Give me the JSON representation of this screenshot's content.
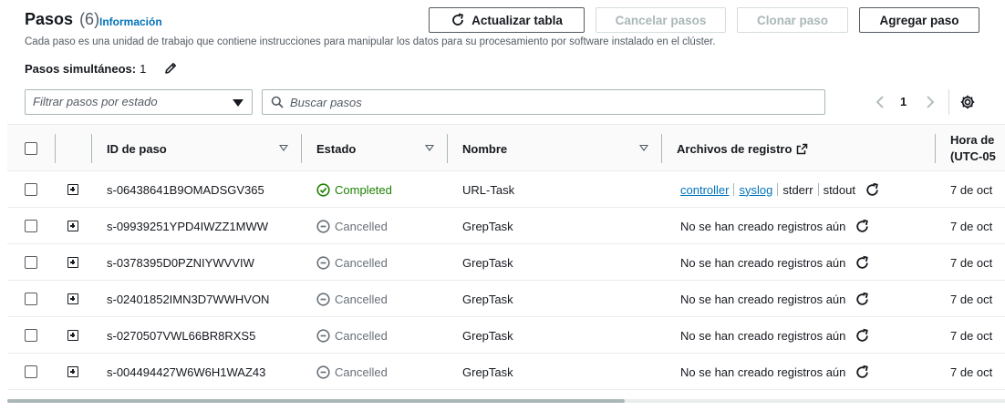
{
  "header": {
    "title": "Pasos",
    "count": "(6)",
    "info_link": "Información",
    "description": "Cada paso es una unidad de trabajo que contiene instrucciones para manipular los datos para su procesamiento por software instalado en el clúster.",
    "concurrent_label": "Pasos simultáneos:",
    "concurrent_value": "1",
    "edit_icon": "pencil-icon"
  },
  "toolbar": {
    "refresh_label": "Actualizar tabla",
    "cancel_label": "Cancelar pasos",
    "clone_label": "Clonar paso",
    "add_label": "Agregar paso"
  },
  "filters": {
    "state_placeholder": "Filtrar pasos por estado",
    "search_placeholder": "Buscar pasos"
  },
  "pagination": {
    "current_page": "1"
  },
  "table": {
    "columns": {
      "id": "ID de paso",
      "state": "Estado",
      "name": "Nombre",
      "logs": "Archivos de registro",
      "time_line1": "Hora de",
      "time_line2": "(UTC-05"
    },
    "rows": [
      {
        "id": "s-06438641B9OMADSGV365",
        "state": "Completed",
        "state_kind": "completed",
        "name": "URL-Task",
        "logs_kind": "links",
        "time": "7 de oct"
      },
      {
        "id": "s-09939251YPD4IWZZ1MWW",
        "state": "Cancelled",
        "state_kind": "cancelled",
        "name": "GrepTask",
        "logs_text": "No se han creado registros aún",
        "logs_kind": "none",
        "time": "7 de oct"
      },
      {
        "id": "s-0378395D0PZNIYWVVIW",
        "state": "Cancelled",
        "state_kind": "cancelled",
        "name": "GrepTask",
        "logs_text": "No se han creado registros aún",
        "logs_kind": "none",
        "time": "7 de oct"
      },
      {
        "id": "s-02401852IMN3D7WWHVON",
        "state": "Cancelled",
        "state_kind": "cancelled",
        "name": "GrepTask",
        "logs_text": "No se han creado registros aún",
        "logs_kind": "none",
        "time": "7 de oct"
      },
      {
        "id": "s-0270507VWL66BR8RXS5",
        "state": "Cancelled",
        "state_kind": "cancelled",
        "name": "GrepTask",
        "logs_text": "No se han creado registros aún",
        "logs_kind": "none",
        "time": "7 de oct"
      },
      {
        "id": "s-004494427W6W6H1WAZ43",
        "state": "Cancelled",
        "state_kind": "cancelled",
        "name": "GrepTask",
        "logs_text": "No se han creado registros aún",
        "logs_kind": "none",
        "time": "7 de oct"
      }
    ],
    "log_links": {
      "controller": "controller",
      "syslog": "syslog",
      "stderr": "stderr",
      "stdout": "stdout"
    }
  },
  "colors": {
    "link": "#0073bb",
    "completed": "#1d8102",
    "cancelled": "#687078",
    "text": "#16191f"
  }
}
